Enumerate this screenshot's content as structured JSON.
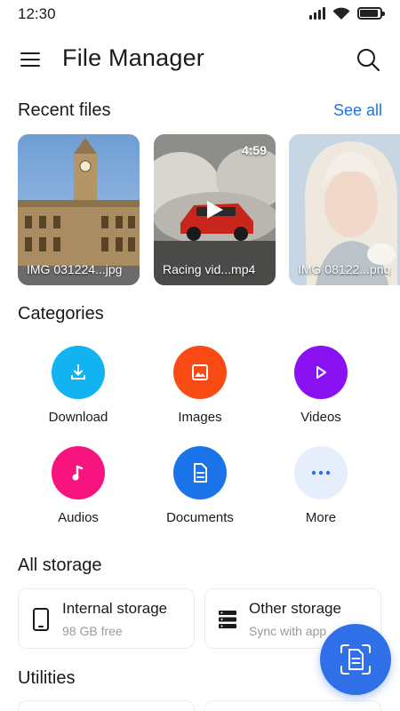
{
  "status_bar": {
    "time": "12:30",
    "battery_level": 0.9
  },
  "app_bar": {
    "title": "File Manager",
    "menu_icon": "hamburger-menu-icon",
    "search_icon": "search-icon"
  },
  "recent_files": {
    "heading": "Recent files",
    "see_all": "See all",
    "items": [
      {
        "name": "IMG 031224...jpg",
        "kind": "image"
      },
      {
        "name": "Racing vid...mp4",
        "kind": "video",
        "duration": "4:59"
      },
      {
        "name": "IMG 08122...png",
        "kind": "image"
      }
    ]
  },
  "categories": {
    "heading": "Categories",
    "items": [
      {
        "label": "Download",
        "icon": "download-icon",
        "color": "#12b3f0"
      },
      {
        "label": "Images",
        "icon": "image-icon",
        "color": "#fb4b14"
      },
      {
        "label": "Videos",
        "icon": "play-icon",
        "color": "#8a12f2"
      },
      {
        "label": "Audios",
        "icon": "music-note-icon",
        "color": "#f7147f"
      },
      {
        "label": "Documents",
        "icon": "document-icon",
        "color": "#1a73e8"
      },
      {
        "label": "More",
        "icon": "more-dots-icon",
        "color": "#e6eefb"
      }
    ]
  },
  "all_storage": {
    "heading": "All storage",
    "cards": [
      {
        "title": "Internal storage",
        "subtitle": "98 GB free",
        "icon": "phone-icon"
      },
      {
        "title": "Other storage",
        "subtitle": "Sync with app",
        "icon": "server-icon"
      }
    ]
  },
  "utilities": {
    "heading": "Utilities"
  },
  "fab": {
    "icon": "scan-document-icon",
    "color": "#2f6fe8"
  }
}
